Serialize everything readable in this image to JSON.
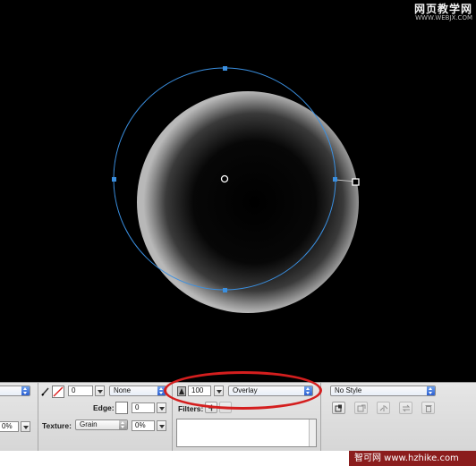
{
  "canvas": {
    "background": "#000000",
    "selection_color": "#3a8fe0",
    "watermark_top_cn": "网页教学网",
    "watermark_top_url": "WWW.WEBJX.COM"
  },
  "properties": {
    "stroke_size": "0",
    "stroke_texture": "None",
    "edge_label": "Edge:",
    "edge_value": "0",
    "texture_label": "Texture:",
    "texture_value": "Grain",
    "texture_amount": "0%",
    "left_amount": "0%",
    "opacity": "100",
    "blend_mode": "Overlay",
    "filters_label": "Filters:",
    "style": "No Style"
  },
  "annotation": {
    "oval_color": "#d41e1e"
  },
  "footer": {
    "text": "智可网 www.hzhike.com",
    "badge_color": "#8b1d1d"
  }
}
